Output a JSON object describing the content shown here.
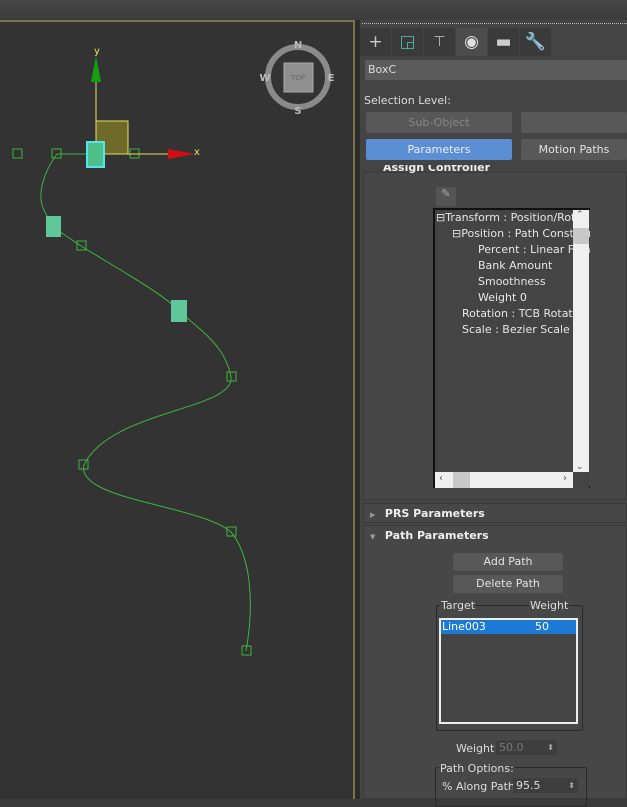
{
  "viewport": {
    "axis_x": "x",
    "axis_y": "y",
    "viewcube": {
      "face": "TOP",
      "north": "N",
      "south": "S",
      "east": "E",
      "west": "W"
    },
    "colors": {
      "spline": "#3db53d",
      "selected": "#56e3f0",
      "grid_bg": "#333333",
      "axis_x": "#d01010",
      "axis_y": "#10a010",
      "gizmo": "#e6e05a"
    }
  },
  "command_panel": {
    "tabs": [
      {
        "icon": "plus-icon",
        "label": "Create"
      },
      {
        "icon": "modify-icon",
        "label": "Modify"
      },
      {
        "icon": "hierarchy-icon",
        "label": "Hierarchy"
      },
      {
        "icon": "motion-icon",
        "label": "Motion",
        "active": true
      },
      {
        "icon": "display-icon",
        "label": "Display"
      },
      {
        "icon": "wrench-icon",
        "label": "Utilities"
      }
    ],
    "object_name": "BoxC",
    "selection_level_label": "Selection Level:",
    "sub_object_button": "Sub-Object",
    "parameters_button": "Parameters",
    "motion_paths_button": "Motion Paths",
    "assign_controller": {
      "title": "Assign Controller",
      "tree": [
        {
          "label": "Transform : Position/Rotation/Scale",
          "level": 0,
          "expander": "⊟"
        },
        {
          "label": "Position : Path Constraint",
          "level": 1,
          "expander": "⊟"
        },
        {
          "label": "Percent : Linear Float",
          "level": 2
        },
        {
          "label": "Bank Amount",
          "level": 2
        },
        {
          "label": "Smoothness",
          "level": 2
        },
        {
          "label": "Weight 0",
          "level": 2
        },
        {
          "label": "Rotation : TCB Rotation",
          "level": 1
        },
        {
          "label": "Scale : Bezier Scale",
          "level": 1
        }
      ]
    },
    "prs_parameters": {
      "title": "PRS Parameters",
      "expanded": false
    },
    "path_parameters": {
      "title": "Path Parameters",
      "expanded": true,
      "add_path": "Add Path",
      "delete_path": "Delete Path",
      "columns": [
        "Target",
        "Weight"
      ],
      "rows": [
        {
          "target": "Line003",
          "weight": "50",
          "selected": true
        }
      ],
      "weight_label": "Weight",
      "weight_value": "50.0",
      "path_options_label": "Path Options:",
      "along_path_label": "% Along Path:",
      "along_path_value": "95.5"
    }
  }
}
